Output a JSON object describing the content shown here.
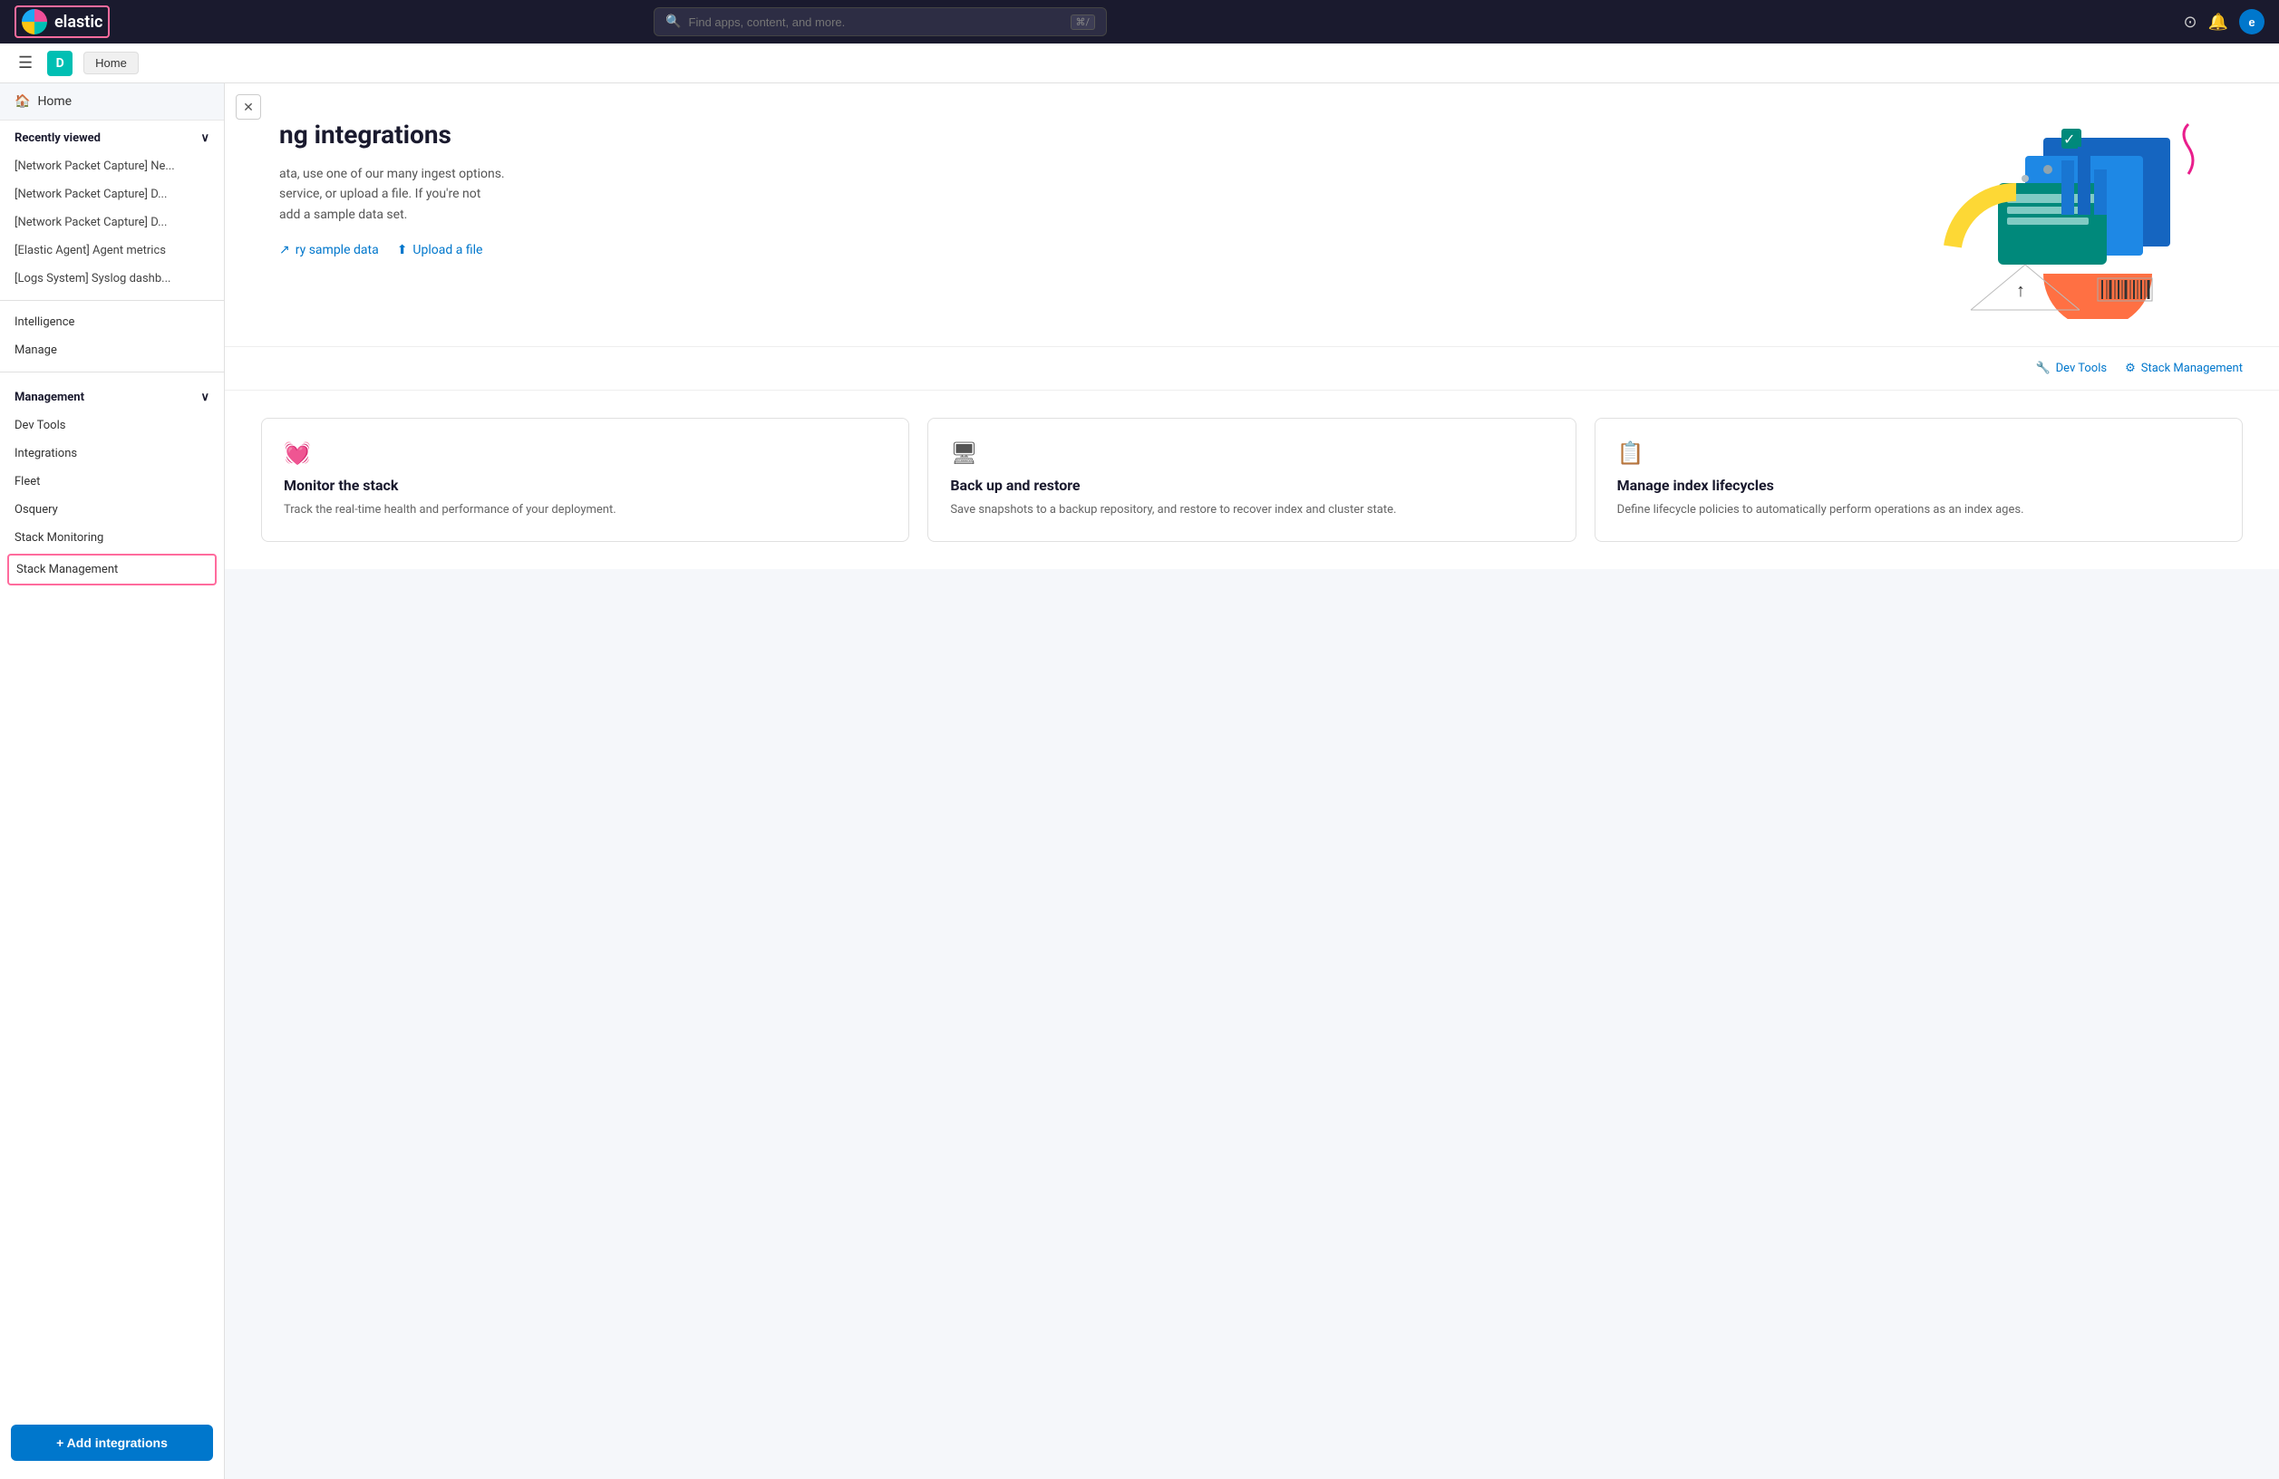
{
  "app": {
    "title": "elastic",
    "logo_letter": "e"
  },
  "topnav": {
    "search_placeholder": "Find apps, content, and more.",
    "search_shortcut": "⌘/",
    "avatar_letter": "e"
  },
  "secondary_nav": {
    "space_letter": "D",
    "home_label": "Home"
  },
  "sidebar": {
    "home_label": "Home",
    "recently_viewed_label": "Recently viewed",
    "recently_viewed_items": [
      "[Network Packet Capture] Ne...",
      "[Network Packet Capture] D...",
      "[Network Packet Capture] D...",
      "[Elastic Agent] Agent metrics",
      "[Logs System] Syslog dashb..."
    ],
    "nav_items": [
      "Intelligence",
      "Manage"
    ],
    "management_label": "Management",
    "management_items": [
      "Dev Tools",
      "Integrations",
      "Fleet",
      "Osquery",
      "Stack Monitoring",
      "Stack Management"
    ],
    "add_integrations_label": "+ Add integrations"
  },
  "hero": {
    "title": "ng integrations",
    "description_line1": "ata, use one of our many ingest options.",
    "description_line2": "service, or upload a file. If you're not",
    "description_line3": "add a sample data set.",
    "try_sample_data_label": "ry sample data",
    "upload_file_label": "Upload a file"
  },
  "quick_links": {
    "dev_tools_label": "Dev Tools",
    "stack_management_label": "Stack Management"
  },
  "cards": [
    {
      "icon": "💓",
      "title": "Monitor the stack",
      "description": "Track the real-time health and performance of your deployment."
    },
    {
      "icon": "🖥",
      "title": "Back up and restore",
      "description": "Save snapshots to a backup repository, and restore to recover index and cluster state."
    },
    {
      "icon": "📋",
      "title": "Manage index lifecycles",
      "description": "Define lifecycle policies to automatically perform operations as an index ages."
    }
  ]
}
